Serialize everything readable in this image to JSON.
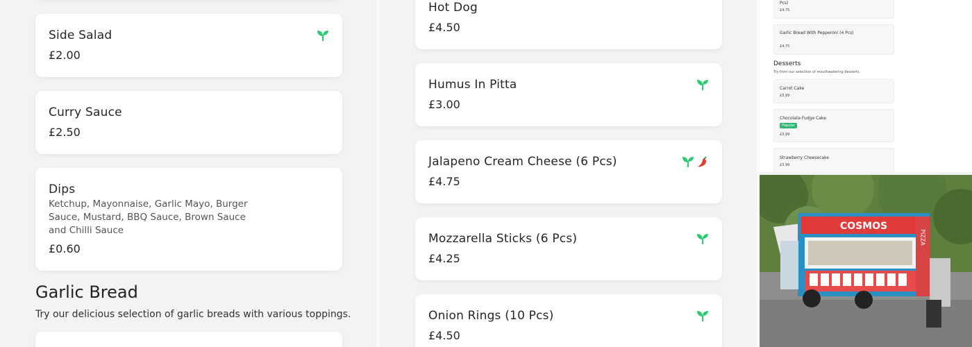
{
  "left_column": {
    "cards": [
      {
        "name": "Side Salad",
        "price": "£2.00",
        "vegetarian": true
      },
      {
        "name": "Curry Sauce",
        "price": "£2.50"
      },
      {
        "name": "Dips",
        "description": "Ketchup, Mayonnaise, Garlic Mayo, Burger Sauce, Mustard, BBQ Sauce, Brown Sauce and Chilli Sauce",
        "price": "£0.60"
      }
    ],
    "section": {
      "title": "Garlic Bread",
      "subtitle": "Try our delicious selection of garlic breads with various toppings."
    }
  },
  "middle_column": {
    "cards": [
      {
        "name": "Hot Dog",
        "price": "£4.50"
      },
      {
        "name": "Humus In Pitta",
        "price": "£3.00",
        "vegetarian": true
      },
      {
        "name": "Jalapeno Cream Cheese (6 Pcs)",
        "price": "£4.75",
        "vegetarian": true,
        "spicy": true
      },
      {
        "name": "Mozzarella Sticks (6 Pcs)",
        "price": "£4.25",
        "vegetarian": true
      },
      {
        "name": "Onion Rings (10 Pcs)",
        "price": "£4.50",
        "vegetarian": true
      }
    ]
  },
  "thumbnail": {
    "top_card": {
      "name": "Pcs)",
      "price": "£4.75"
    },
    "card2": {
      "name": "Garlic Bread With Pepperoni (4 Pcs)",
      "price": "£4.75"
    },
    "section_title": "Desserts",
    "section_sub": "Try from our selection of mouthwatering desserts.",
    "desserts": [
      {
        "name": "Carrot Cake",
        "price": "£3.99"
      },
      {
        "name": "Chocolate Fudge Cake",
        "badge": "Popular",
        "price": "£3.99"
      },
      {
        "name": "Strawberry Cheesecake",
        "price": "£3.99"
      }
    ]
  },
  "photo": {
    "sign_text": "COSMOS",
    "side_text": "PIZZA"
  },
  "colors": {
    "leaf": "#2ecc71",
    "chilli": "#e0402f",
    "background": "#f3f3f4",
    "card": "#ffffff"
  },
  "icons": {
    "vegetarian": "leaf-icon",
    "spicy": "chilli-icon"
  }
}
